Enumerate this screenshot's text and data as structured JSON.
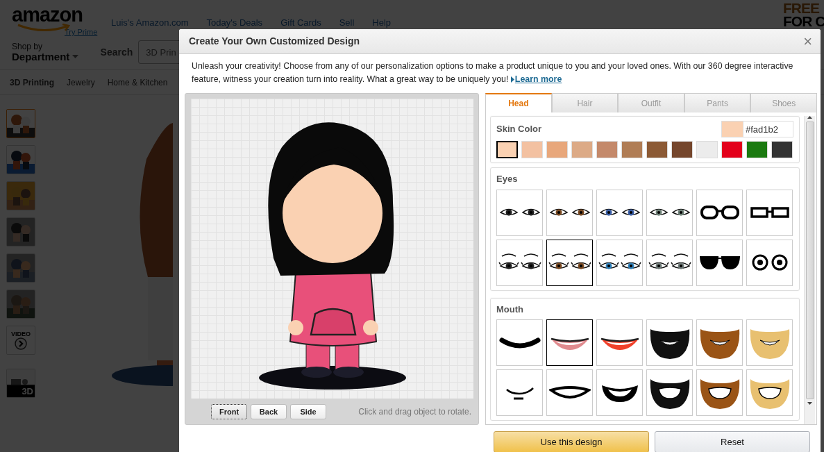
{
  "store_header": {
    "logo": "amazon",
    "prime_link": "Try Prime",
    "nav_links": [
      "Luis's Amazon.com",
      "Today's Deals",
      "Gift Cards",
      "Sell",
      "Help"
    ],
    "shop_by": "Shop by",
    "department": "Department",
    "search_label": "Search",
    "search_value": "3D Prin",
    "categories": [
      "3D Printing",
      "Jewelry",
      "Home & Kitchen"
    ],
    "ad_lines": [
      "FREE",
      "FOR C"
    ]
  },
  "product_gallery": {
    "thumbnails": [
      {
        "kind": "picture",
        "selected": true
      },
      {
        "kind": "picture",
        "selected": false
      },
      {
        "kind": "picture",
        "selected": false
      },
      {
        "kind": "picture",
        "selected": false
      },
      {
        "kind": "picture",
        "selected": false
      },
      {
        "kind": "picture",
        "selected": false
      },
      {
        "kind": "video",
        "label": "VIDEO",
        "selected": false
      },
      {
        "kind": "model",
        "label": "3D",
        "selected": false
      }
    ]
  },
  "dialog": {
    "title": "Create Your Own Customized Design",
    "close": "×",
    "intro": "Unleash your creativity! Choose from any of our personalization options to make a product unique to you and your loved ones. With our 360 degree interactive feature, witness your creation turn into reality. What a great way to be uniquely you!",
    "learn_more": "Learn more",
    "view_buttons": [
      {
        "label": "Front",
        "selected": true
      },
      {
        "label": "Back",
        "selected": false
      },
      {
        "label": "Side",
        "selected": false
      }
    ],
    "rotate_hint": "Click and drag object to rotate.",
    "tabs": [
      {
        "label": "Head",
        "selected": true
      },
      {
        "label": "Hair",
        "selected": false
      },
      {
        "label": "Outfit",
        "selected": false
      },
      {
        "label": "Pants",
        "selected": false
      },
      {
        "label": "Shoes",
        "selected": false
      }
    ],
    "skin_color": {
      "heading": "Skin Color",
      "value": "#fad1b2",
      "swatches": [
        {
          "color": "#fad1b2",
          "selected": true
        },
        {
          "color": "#f3c1a1",
          "selected": false
        },
        {
          "color": "#e8a77b",
          "selected": false
        },
        {
          "color": "#dcaa86",
          "selected": false
        },
        {
          "color": "#c4896a",
          "selected": false
        },
        {
          "color": "#b07d55",
          "selected": false
        },
        {
          "color": "#8c5a35",
          "selected": false
        },
        {
          "color": "#75462c",
          "selected": false
        },
        {
          "color": "#ececec",
          "selected": false
        },
        {
          "color": "#e3001b",
          "selected": false
        },
        {
          "color": "#1b7a10",
          "selected": false
        },
        {
          "color": "#333333",
          "selected": false
        }
      ]
    },
    "eyes": {
      "heading": "Eyes",
      "options": [
        {
          "kind": "eyes",
          "color": "#222222",
          "selected": false
        },
        {
          "kind": "eyes",
          "color": "#7a4a22",
          "selected": false
        },
        {
          "kind": "eyes",
          "color": "#3a5fa8",
          "selected": false
        },
        {
          "kind": "eyes",
          "color": "#6f8278",
          "selected": false
        },
        {
          "kind": "round-glasses",
          "selected": false
        },
        {
          "kind": "square-glasses",
          "selected": false
        },
        {
          "kind": "lashes",
          "color": "#222222",
          "selected": false
        },
        {
          "kind": "lashes",
          "color": "#7a4a22",
          "selected": true
        },
        {
          "kind": "lashes",
          "color": "#2f7fb8",
          "selected": false
        },
        {
          "kind": "lashes",
          "color": "#6f7a78",
          "selected": false
        },
        {
          "kind": "sunglasses",
          "selected": false
        },
        {
          "kind": "googly",
          "selected": false
        }
      ]
    },
    "mouth": {
      "heading": "Mouth",
      "options": [
        {
          "kind": "bar",
          "selected": false
        },
        {
          "kind": "lips",
          "color": "#e08a8e",
          "selected": true
        },
        {
          "kind": "lips",
          "color": "#f0402a",
          "selected": false
        },
        {
          "kind": "beard",
          "color": "#111111",
          "selected": false
        },
        {
          "kind": "beard",
          "color": "#9a5416",
          "selected": false
        },
        {
          "kind": "beard",
          "color": "#e8c070",
          "selected": false
        },
        {
          "kind": "smirk",
          "selected": false
        },
        {
          "kind": "grin",
          "selected": false
        },
        {
          "kind": "open-grin",
          "selected": false
        },
        {
          "kind": "beard-grin",
          "color": "#111111",
          "selected": false
        },
        {
          "kind": "beard-grin",
          "color": "#9a5416",
          "selected": false
        },
        {
          "kind": "beard-grin",
          "color": "#e8c070",
          "selected": false
        }
      ]
    },
    "buttons": [
      {
        "label": "Use this design",
        "kind": "primary"
      },
      {
        "label": "Reset",
        "kind": "secondary"
      }
    ]
  }
}
